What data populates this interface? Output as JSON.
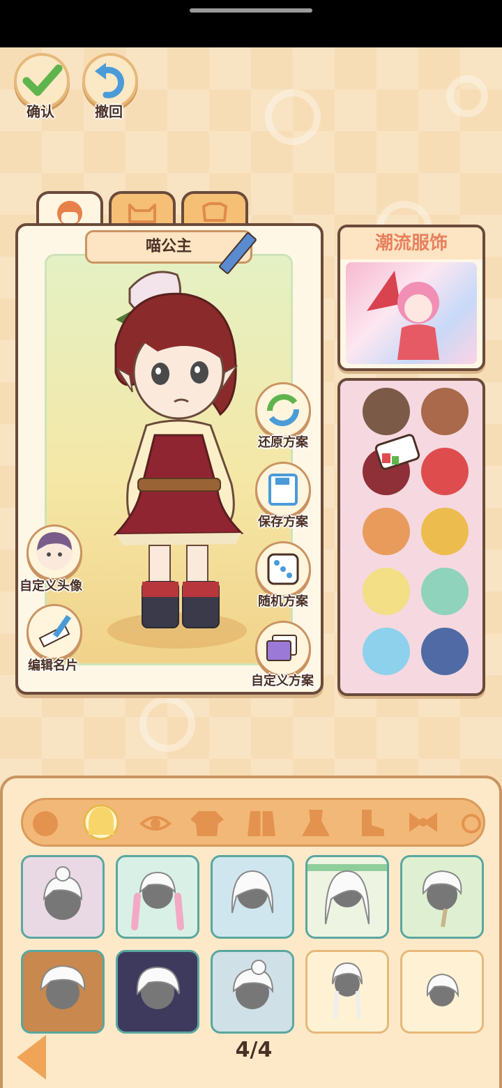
{
  "top_buttons": {
    "confirm_label": "确认",
    "undo_label": "撤回"
  },
  "character": {
    "name": "喵公主"
  },
  "side_actions": {
    "restore": "还原方案",
    "save": "保存方案",
    "random": "随机方案",
    "custom_plan": "自定义方案",
    "custom_avatar": "自定义头像",
    "edit_card": "编辑名片"
  },
  "fashion_panel": {
    "title": "潮流服饰"
  },
  "color_swatches": [
    "#7b5a48",
    "#a9694a",
    "#8f2f38",
    "#df4c4e",
    "#e99b5c",
    "#ecbd4e",
    "#f2df86",
    "#8fd3bd",
    "#8ed1ec",
    "#4f6aa4"
  ],
  "categories": [
    "face-shape",
    "hair",
    "eyes",
    "top",
    "coat",
    "dress",
    "shoes",
    "accessory"
  ],
  "pagination": {
    "page": "4/4"
  }
}
